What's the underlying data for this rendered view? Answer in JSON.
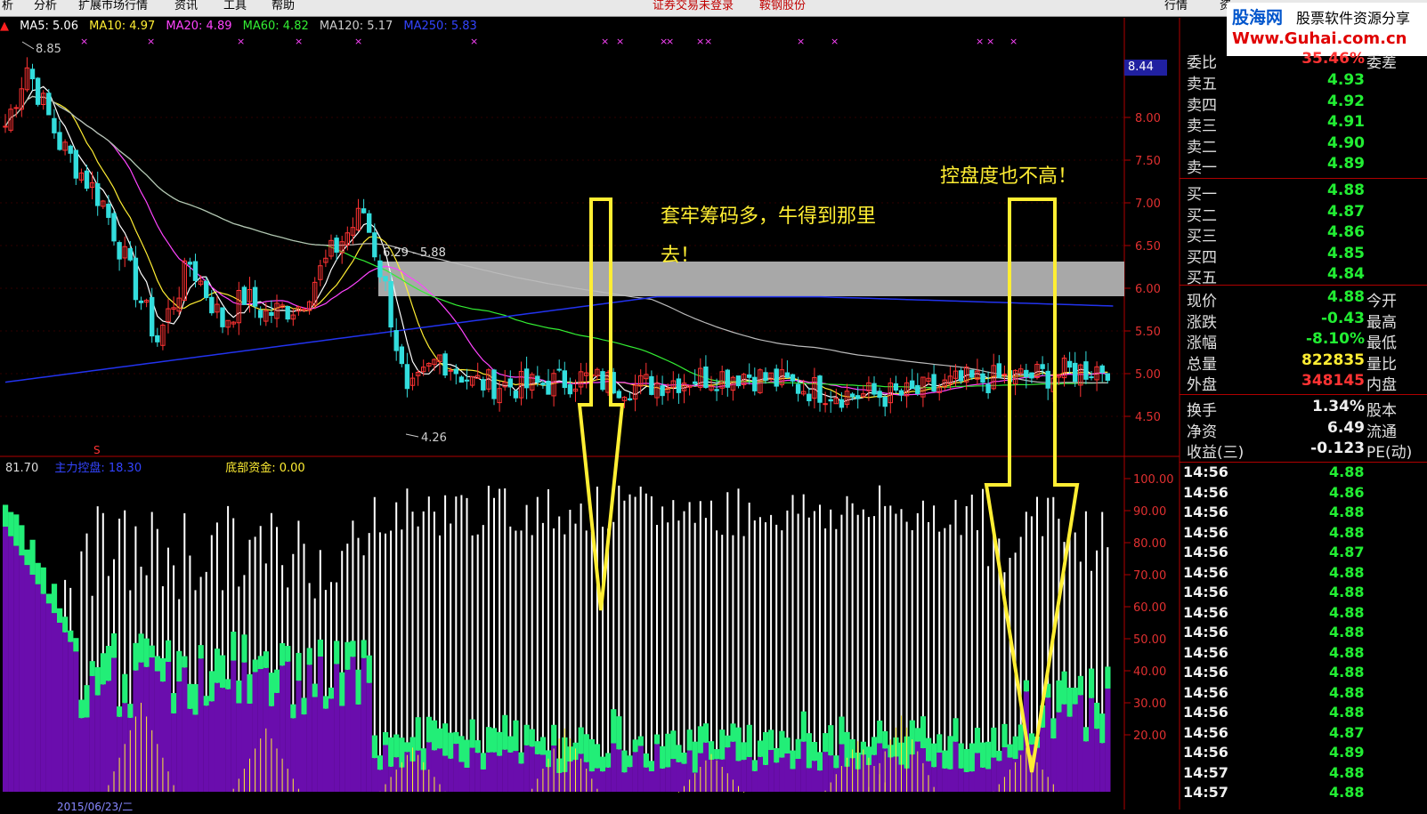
{
  "menu": {
    "items": [
      "析",
      "分析",
      "扩展市场行情",
      "资讯",
      "工具",
      "帮助"
    ],
    "notice": "证券交易未登录",
    "stock_name": "鞍钢股份",
    "right_tabs": [
      "行情",
      "资"
    ]
  },
  "logo": {
    "brand": "股海网",
    "slogan": "股票软件资源分享",
    "url": "Www.Guhai.com.cn"
  },
  "ma_legend": [
    {
      "label": "MA5: 5.06",
      "color": "#ffffff"
    },
    {
      "label": "MA10: 4.97",
      "color": "#ffee33"
    },
    {
      "label": "MA20: 4.89",
      "color": "#ff44ff"
    },
    {
      "label": "MA60: 4.82",
      "color": "#33ee33"
    },
    {
      "label": "MA120: 5.17",
      "color": "#cccccc"
    },
    {
      "label": "MA250: 5.83",
      "color": "#3344ff"
    }
  ],
  "sub_legend": {
    "first": "81.70",
    "zhuli": "主力控盘: 18.30",
    "dibu": "底部资金: 0.00"
  },
  "main_chart": {
    "price_axis": [
      "8.00",
      "7.50",
      "7.00",
      "6.50",
      "6.00",
      "5.50",
      "5.00",
      "4.50"
    ],
    "high_label": "8.85",
    "low_label": "4.26",
    "range_label": "6.29 - 5.88",
    "current_price_box": "8.44"
  },
  "sub_chart": {
    "axis": [
      "100.00",
      "90.00",
      "80.00",
      "70.00",
      "60.00",
      "50.00",
      "40.00",
      "30.00",
      "20.00"
    ]
  },
  "annotations": {
    "left_text_1": "套牢筹码多，牛得到那里",
    "left_text_2": "去！",
    "right_text": "控盘度也不高！"
  },
  "quote": {
    "weibi": {
      "label": "委比",
      "value": "35.46%",
      "label2": "委差"
    },
    "sell": [
      {
        "label": "卖五",
        "value": "4.93"
      },
      {
        "label": "卖四",
        "value": "4.92"
      },
      {
        "label": "卖三",
        "value": "4.91"
      },
      {
        "label": "卖二",
        "value": "4.90"
      },
      {
        "label": "卖一",
        "value": "4.89"
      }
    ],
    "buy": [
      {
        "label": "买一",
        "value": "4.88"
      },
      {
        "label": "买二",
        "value": "4.87"
      },
      {
        "label": "买三",
        "value": "4.86"
      },
      {
        "label": "买四",
        "value": "4.85"
      },
      {
        "label": "买五",
        "value": "4.84"
      }
    ],
    "stats": [
      {
        "label": "现价",
        "value": "4.88",
        "label2": "今开",
        "color": "green"
      },
      {
        "label": "涨跌",
        "value": "-0.43",
        "label2": "最高",
        "color": "green"
      },
      {
        "label": "涨幅",
        "value": "-8.10%",
        "label2": "最低",
        "color": "green"
      },
      {
        "label": "总量",
        "value": "822835",
        "label2": "量比",
        "color": "yellow"
      },
      {
        "label": "外盘",
        "value": "348145",
        "label2": "内盘",
        "color": "red"
      }
    ],
    "fin": [
      {
        "label": "换手",
        "value": "1.34%",
        "label2": "股本"
      },
      {
        "label": "净资",
        "value": "6.49",
        "label2": "流通"
      },
      {
        "label": "收益(三)",
        "value": "-0.123",
        "label2": "PE(动)"
      }
    ],
    "ticks": [
      {
        "time": "14:56",
        "price": "4.88"
      },
      {
        "time": "14:56",
        "price": "4.86"
      },
      {
        "time": "14:56",
        "price": "4.88"
      },
      {
        "time": "14:56",
        "price": "4.88"
      },
      {
        "time": "14:56",
        "price": "4.87"
      },
      {
        "time": "14:56",
        "price": "4.88"
      },
      {
        "time": "14:56",
        "price": "4.88"
      },
      {
        "time": "14:56",
        "price": "4.88"
      },
      {
        "time": "14:56",
        "price": "4.88"
      },
      {
        "time": "14:56",
        "price": "4.88"
      },
      {
        "time": "14:56",
        "price": "4.88"
      },
      {
        "time": "14:56",
        "price": "4.88"
      },
      {
        "time": "14:56",
        "price": "4.88"
      },
      {
        "time": "14:56",
        "price": "4.87"
      },
      {
        "time": "14:56",
        "price": "4.89"
      },
      {
        "time": "14:57",
        "price": "4.88"
      },
      {
        "time": "14:57",
        "price": "4.88"
      }
    ]
  },
  "bottom": {
    "date": "2015/06/23/二"
  },
  "colors": {
    "up": "#ff3333",
    "down": "#33dddd",
    "axis": "#b00000"
  }
}
